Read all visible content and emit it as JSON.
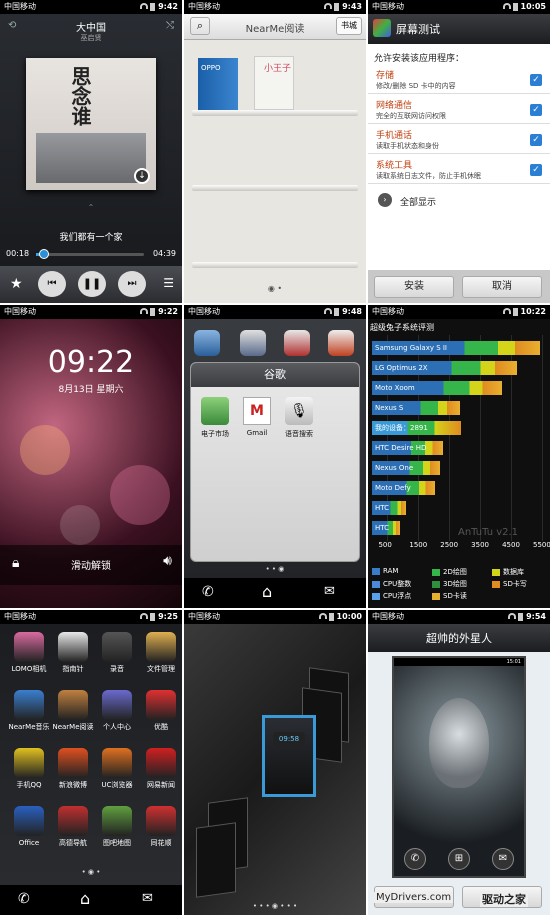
{
  "status": {
    "carrier": "中国移动",
    "t1": "9:42",
    "t2": "9:43",
    "t3": "10:05",
    "t4": "9:22",
    "t5": "9:48",
    "t6": "10:22",
    "t7": "9:25",
    "t8": "10:00",
    "t9": "9:54"
  },
  "music": {
    "title": "大中国",
    "artist": "巫启贤",
    "album_text": "思念谁",
    "lyric": "我们都有一个家",
    "elapsed": "00:18",
    "total": "04:39",
    "progress": 0.07
  },
  "reader": {
    "app_title": "NearMe阅读",
    "store_label": "书城",
    "book1": "OPPO",
    "book2": "小王子"
  },
  "install": {
    "title": "屏幕测试",
    "prompt": "允许安装该应用程序：",
    "perms": [
      {
        "t": "存储",
        "s": "修改/删除 SD 卡中的内容"
      },
      {
        "t": "网络通信",
        "s": "完全的互联网访问权限"
      },
      {
        "t": "手机通话",
        "s": "读取手机状态和身份"
      },
      {
        "t": "系统工具",
        "s": "读取系统日志文件，防止手机休眠"
      }
    ],
    "show_all": "全部显示",
    "install_label": "安装",
    "cancel_label": "取消"
  },
  "lock": {
    "time": "09:22",
    "date": "8月13日 星期六",
    "unlock": "滑动解锁"
  },
  "folder": {
    "title": "谷歌",
    "apps": [
      "电子市场",
      "Gmail",
      "语音搜索"
    ]
  },
  "bench": {
    "title": "超级兔子系统评测",
    "watermark": "AnTuTu v2.1",
    "xticks": [
      "500",
      "1500",
      "2500",
      "3500",
      "4500",
      "5500"
    ],
    "legend": [
      {
        "name": "RAM",
        "color": "#3b7cc9"
      },
      {
        "name": "2D绘图",
        "color": "#36b54a"
      },
      {
        "name": "数据库",
        "color": "#d4d41a"
      },
      {
        "name": "CPU整数",
        "color": "#4a8ad8"
      },
      {
        "name": "3D绘图",
        "color": "#2f8f3a"
      },
      {
        "name": "SD卡写",
        "color": "#e08a20"
      },
      {
        "name": "CPU浮点",
        "color": "#5aa0e8"
      },
      {
        "name": "SD卡读",
        "color": "#e8b030"
      }
    ]
  },
  "chart_data": {
    "type": "bar",
    "title": "超级兔子系统评测",
    "categories": [
      "Samsung Galaxy S II",
      "LG Optimus 2X",
      "Moto Xoom",
      "Nexus S",
      "我的设备：2891",
      "HTC Desire HD",
      "Nexus One",
      "Moto Defy",
      "HTC Hero",
      "HTC Wildfire"
    ],
    "values": [
      5450,
      4700,
      4200,
      2850,
      2891,
      2300,
      2200,
      2050,
      1100,
      900
    ],
    "xlim": [
      0,
      5500
    ],
    "xticks": [
      500,
      1500,
      2500,
      3500,
      4500,
      5500
    ]
  },
  "launcher": {
    "apps": [
      "LOMO相机",
      "指南针",
      "录音",
      "文件管理",
      "NearMe音乐",
      "NearMe阅读",
      "个人中心",
      "优酷",
      "手机QQ",
      "新浪微博",
      "UC浏览器",
      "网易新闻",
      "Office",
      "高德导航",
      "图吧地图",
      "同花顺"
    ]
  },
  "switcher": {
    "time": "09:58"
  },
  "theme": {
    "title": "超帅的外星人",
    "time": "15:01"
  },
  "footer": {
    "site": "MyDrivers.com",
    "brand": "驱动之家"
  }
}
